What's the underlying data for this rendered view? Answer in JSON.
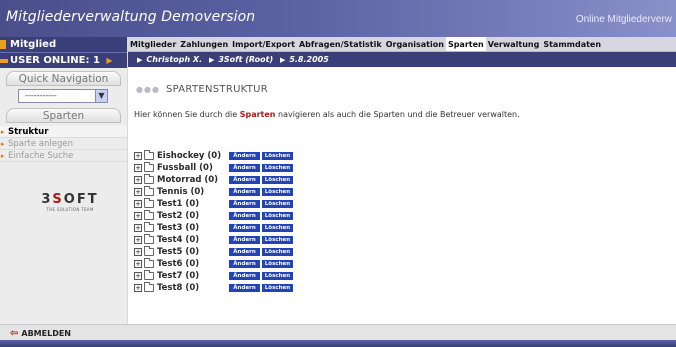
{
  "app": {
    "title": "Mitgliederverwaltung Demoversion",
    "banner_right": "Online Mitgliederverw"
  },
  "sidebar": {
    "header": "Mitglied",
    "user_online": "USER ONLINE: 1",
    "quick_nav_title": "Quick Navigation",
    "quick_nav_value": "-----------",
    "section_title": "Sparten",
    "items": [
      {
        "label": "Struktur",
        "active": true
      },
      {
        "label": "Sparte anlegen",
        "active": false
      },
      {
        "label": "Einfache Suche",
        "active": false
      }
    ],
    "logo_text": "3SOFT",
    "logo_tagline": "THE SOLUTION TEAM"
  },
  "topnav": {
    "items": [
      "Mitglieder",
      "Zahlungen",
      "Import/Export",
      "Abfragen/Statistik",
      "Organisation",
      "Sparten",
      "Verwaltung",
      "Stammdaten"
    ],
    "active": "Sparten"
  },
  "breadcrumb": {
    "user": "Christoph X.",
    "org": "3Soft (Root)",
    "date": "5.8.2005"
  },
  "main": {
    "heading": "SPARTENSTRUKTUR",
    "intro_before": "Hier können Sie durch die",
    "intro_highlight": "Sparten",
    "intro_after": "navigieren als auch die Sparten und die Betreuer verwalten.",
    "edit_label": "Ändern",
    "delete_label": "Löschen",
    "tree": [
      "Eishockey (0)",
      "Fussball (0)",
      "Motorrad (0)",
      "Tennis (0)",
      "Test1 (0)",
      "Test2 (0)",
      "Test3 (0)",
      "Test4 (0)",
      "Test5 (0)",
      "Test6 (0)",
      "Test7 (0)",
      "Test8 (0)"
    ]
  },
  "footer": {
    "logout": "ABMELDEN"
  }
}
